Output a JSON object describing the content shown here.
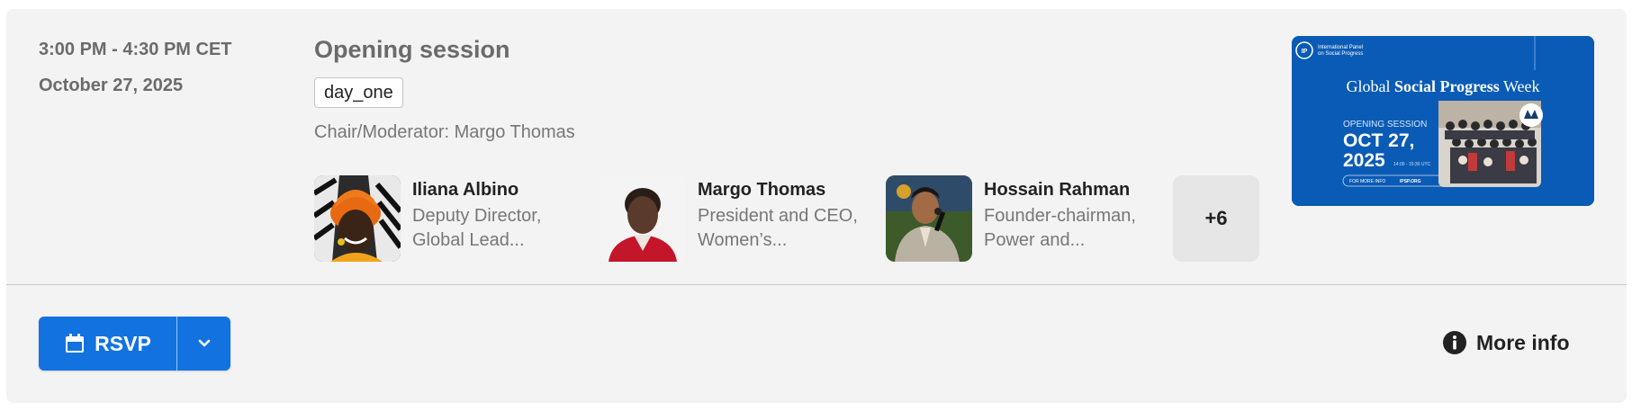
{
  "event": {
    "time": "3:00 PM - 4:30 PM CET",
    "date": "October 27, 2025",
    "title": "Opening session",
    "tag": "day_one",
    "chair_label": "Chair/Moderator:",
    "chair_name": "Margo Thomas"
  },
  "speakers": [
    {
      "name": "Iliana Albino",
      "role": "Deputy Director, Global Lead..."
    },
    {
      "name": "Margo Thomas",
      "role": "President and CEO, Women’s..."
    },
    {
      "name": "Hossain Rahman",
      "role": "Founder-chairman, Power and..."
    }
  ],
  "more_speakers": "+6",
  "banner": {
    "org_line1": "International Panel",
    "org_line2": "on Social Progress",
    "heading_prefix": "Global ",
    "heading_bold": "Social Progress",
    "heading_suffix": " Week",
    "session": "OPENING SESSION",
    "date_line1": "OCT 27,",
    "date_line2": "2025",
    "time_utc": "14:00 - 15:30 UTC",
    "footer_left": "FOR MORE INFO",
    "footer_right": "IPSP.ORG",
    "logo_text": "IP",
    "background_color": "#0a5bb5"
  },
  "actions": {
    "rsvp_label": "RSVP",
    "more_info_label": "More info",
    "primary_color": "#1273e0"
  }
}
